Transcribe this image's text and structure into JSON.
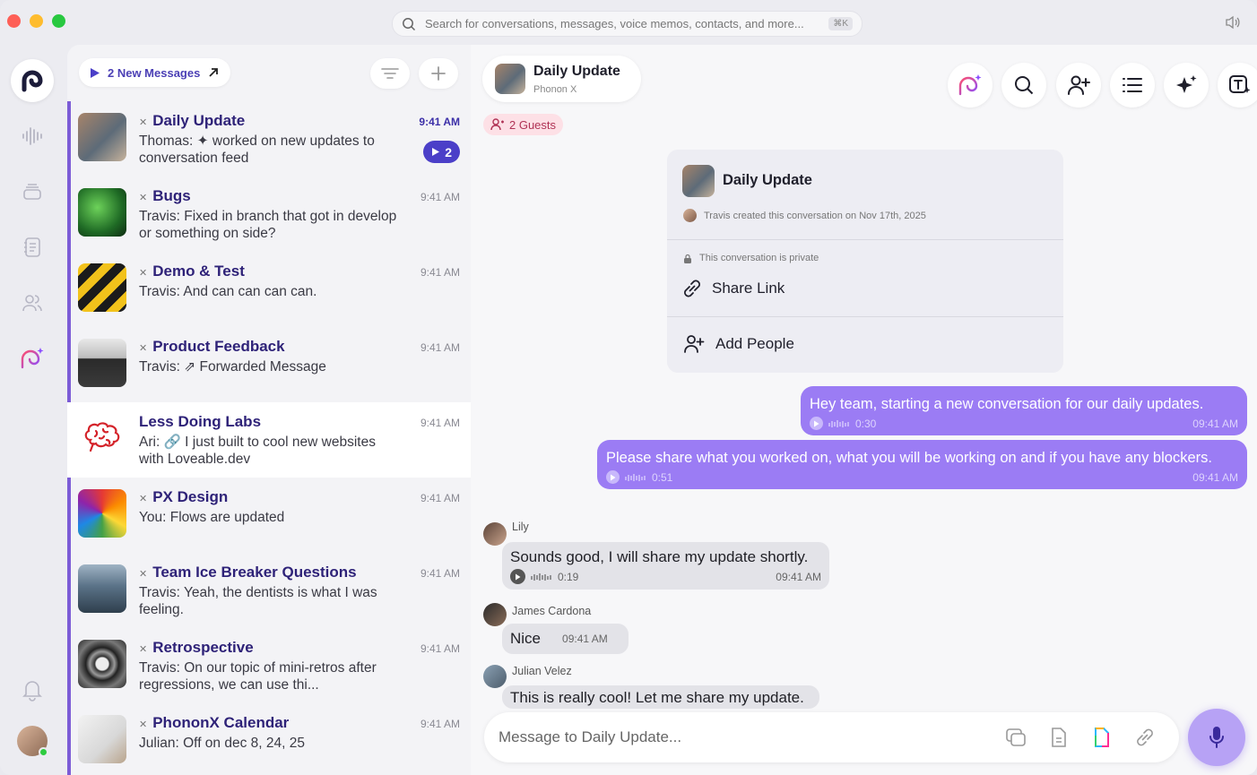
{
  "search": {
    "placeholder": "Search for conversations, messages, voice memos, contacts, and more...",
    "shortcut": "⌘K"
  },
  "list_header": {
    "new_messages": "2 New Messages"
  },
  "conversations": [
    {
      "title": "Daily Update",
      "preview": "Thomas: ✦ worked on new updates to conversation feed",
      "time": "9:41 AM",
      "badge": "2",
      "unread": true
    },
    {
      "title": "Bugs",
      "preview": "Travis: Fixed in branch that got in develop or something on side?",
      "time": "9:41 AM"
    },
    {
      "title": "Demo & Test",
      "preview": "Travis: And can can can can.",
      "time": "9:41 AM"
    },
    {
      "title": "Product Feedback",
      "preview": "Travis: ⇗ Forwarded Message",
      "time": "9:41 AM"
    },
    {
      "title": "Less Doing Labs",
      "preview": "Ari: 🔗 I just built to cool new websites with Loveable.dev",
      "time": "9:41 AM"
    },
    {
      "title": "PX Design",
      "preview": "You: Flows are updated",
      "time": "9:41 AM"
    },
    {
      "title": "Team Ice Breaker Questions",
      "preview": "Travis: Yeah, the dentists is what I was feeling.",
      "time": "9:41 AM"
    },
    {
      "title": "Retrospective",
      "preview": "Travis: On our topic of mini-retros after regressions, we can use thi...",
      "time": "9:41 AM"
    },
    {
      "title": "PhononX Calendar",
      "preview": "Julian: Off on dec 8, 24, 25",
      "time": "9:41 AM"
    }
  ],
  "chat": {
    "title": "Daily Update",
    "subtitle": "Phonon X",
    "guests": "2 Guests",
    "info": {
      "title": "Daily Update",
      "created": "Travis created this conversation on Nov 17th, 2025",
      "private": "This conversation is private",
      "share": "Share Link",
      "add_people": "Add People"
    },
    "outgoing": [
      {
        "text": "Hey team, starting a new conversation for our daily updates.",
        "duration": "0:30",
        "time": "09:41 AM"
      },
      {
        "text": "Please share what you worked on, what you will be working on and if you have any blockers.",
        "duration": "0:51",
        "time": "09:41 AM"
      }
    ],
    "incoming": [
      {
        "sender": "Lily",
        "text": "Sounds good, I will share my update shortly.",
        "duration": "0:19",
        "time": "09:41 AM"
      },
      {
        "sender": "James Cardona",
        "text": "Nice",
        "time": "09:41 AM"
      },
      {
        "sender": "Julian Velez",
        "text": "This is really cool! Let me share my update."
      }
    ],
    "composer_placeholder": "Message to Daily Update..."
  },
  "colors": {
    "accent": "#9b7cf4",
    "brand_dark": "#2e2278",
    "guests_bg": "#fde0e6"
  }
}
